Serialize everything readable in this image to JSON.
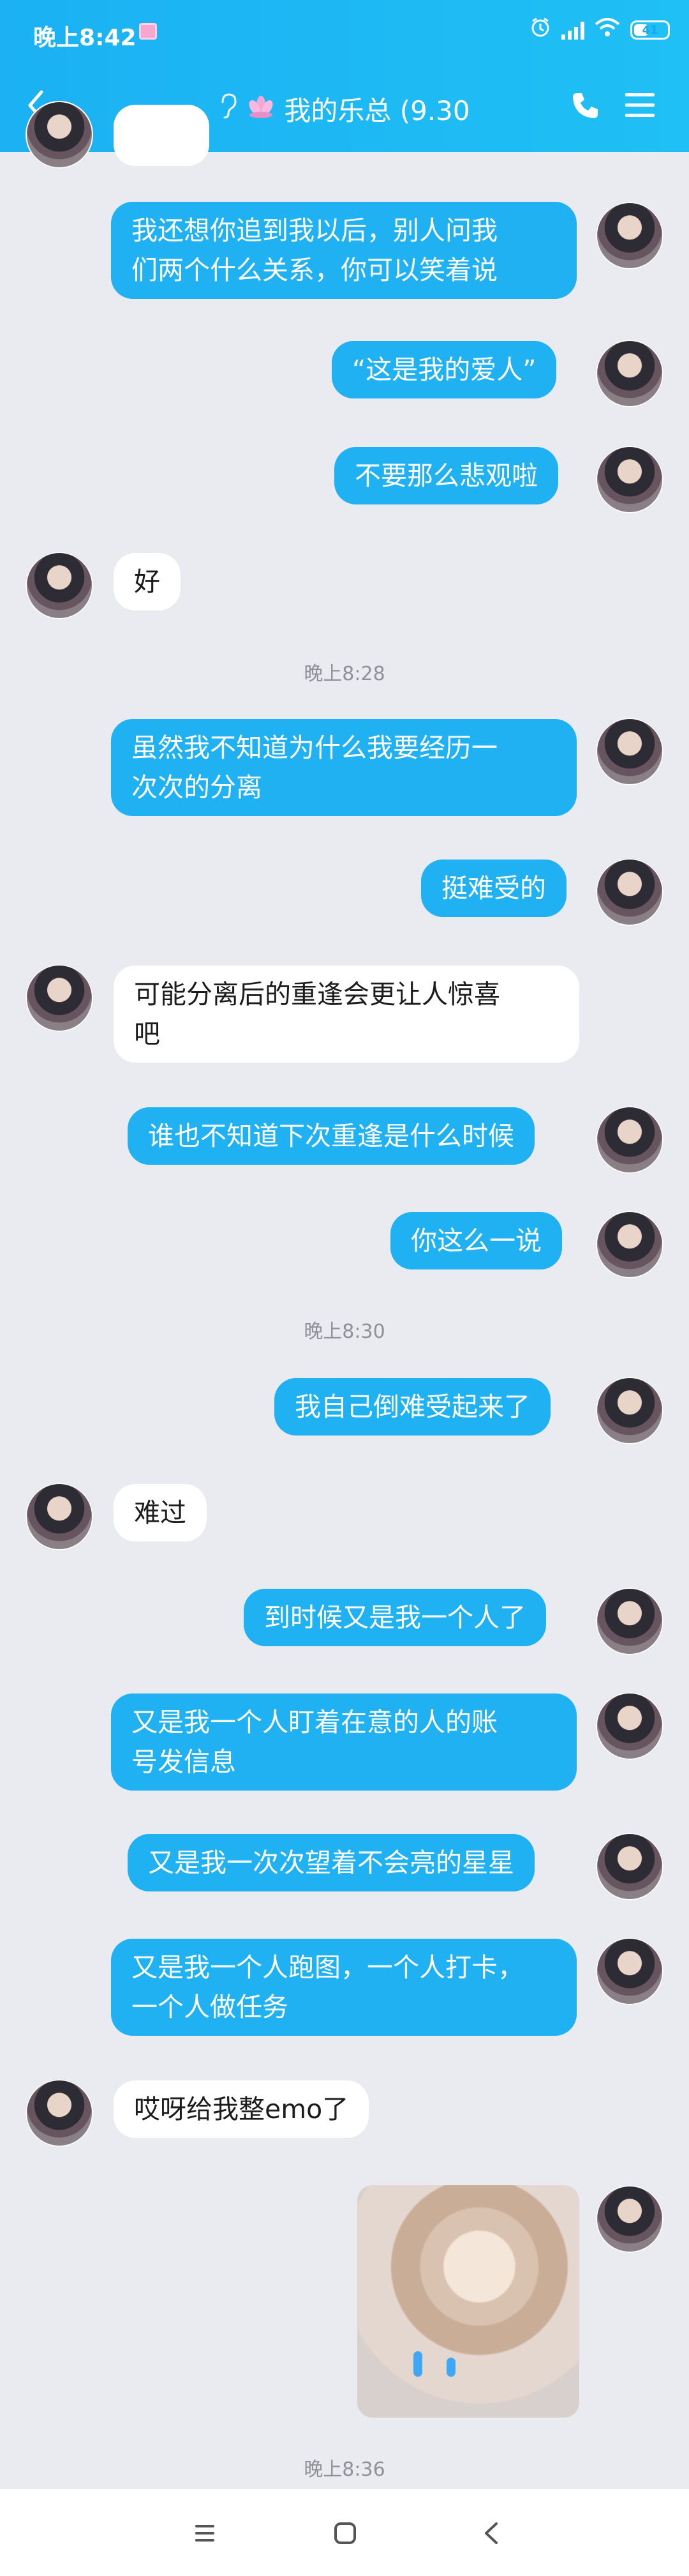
{
  "status_bar": {
    "time": "晚上8:42",
    "battery": "41"
  },
  "header": {
    "title": "我的乐总 (9.30",
    "ear_icon": "ear-icon",
    "lotus_icon": "lotus-emoji-icon"
  },
  "messages": [
    {
      "type": "out",
      "text": "我还想你追到我以后，别人问我\n们两个什么关系，你可以笑着说"
    },
    {
      "type": "out",
      "text": "“这是我的爱人”"
    },
    {
      "type": "out",
      "text": "不要那么悲观啦"
    },
    {
      "type": "in",
      "text": "好"
    },
    {
      "type": "time",
      "text": "晚上8:28"
    },
    {
      "type": "out",
      "text": "虽然我不知道为什么我要经历一\n次次的分离"
    },
    {
      "type": "out",
      "text": "挺难受的"
    },
    {
      "type": "in",
      "text": "可能分离后的重逢会更让人惊喜\n吧"
    },
    {
      "type": "out",
      "text": "谁也不知道下次重逢是什么时候"
    },
    {
      "type": "out",
      "text": "你这么一说"
    },
    {
      "type": "time",
      "text": "晚上8:30"
    },
    {
      "type": "out",
      "text": "我自己倒难受起来了"
    },
    {
      "type": "in",
      "text": "难过"
    },
    {
      "type": "out",
      "text": "到时候又是我一个人了"
    },
    {
      "type": "out",
      "text": "又是我一个人盯着在意的人的账\n号发信息"
    },
    {
      "type": "out",
      "text": "又是我一次次望着不会亮的星星"
    },
    {
      "type": "out",
      "text": "又是我一个人跑图，一个人打卡，\n一个人做任务"
    },
    {
      "type": "in",
      "text": "哎呀给我整emo了"
    },
    {
      "type": "time",
      "text": "晚上8:36"
    }
  ]
}
